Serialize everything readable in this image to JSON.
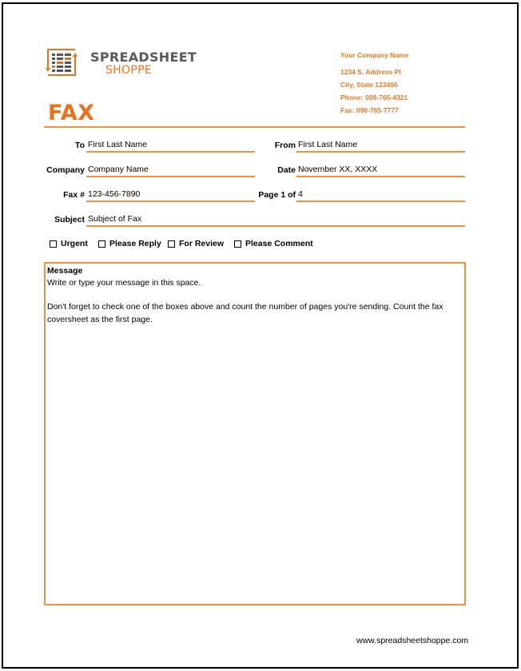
{
  "logo": {
    "line1": "SPREADSHEET",
    "line2": "SHOPPE",
    "icon": "spreadsheet-arrows-icon"
  },
  "company": {
    "name": "Your Company Name",
    "address": "1234 S. Address Pl",
    "city": "City, State 123456",
    "phone": "Phone: 098-765-4321",
    "fax": "Fax: 098-765-7777"
  },
  "title": "FAX",
  "fields": {
    "to": {
      "label": "To",
      "value": "First Last Name"
    },
    "from": {
      "label": "From",
      "value": "First Last Name"
    },
    "company": {
      "label": "Company",
      "value": "Company Name"
    },
    "date": {
      "label": "Date",
      "value": "November XX, XXXX"
    },
    "fax": {
      "label": "Fax #",
      "value": "123-456-7890"
    },
    "pages": {
      "label": "Page 1 of",
      "value": "4"
    },
    "subject": {
      "label": "Subject",
      "value": "Subject of Fax"
    }
  },
  "checkboxes": [
    {
      "label": "Urgent",
      "checked": false
    },
    {
      "label": "Please Reply",
      "checked": false
    },
    {
      "label": "For Review",
      "checked": false
    },
    {
      "label": "Please Comment",
      "checked": false
    }
  ],
  "message": {
    "title": "Message",
    "line1": "Write or type your message in this space.",
    "line2": "Don't forget to check one of the boxes above and count the number of pages you're sending.  Count the fax",
    "line3": "coversheet as the first page."
  },
  "footer": {
    "url": "www.spreadsheetshoppe.com"
  },
  "colors": {
    "accent": "#e8731f",
    "rule": "#f0913f",
    "logo_gray": "#5a5a5a"
  }
}
